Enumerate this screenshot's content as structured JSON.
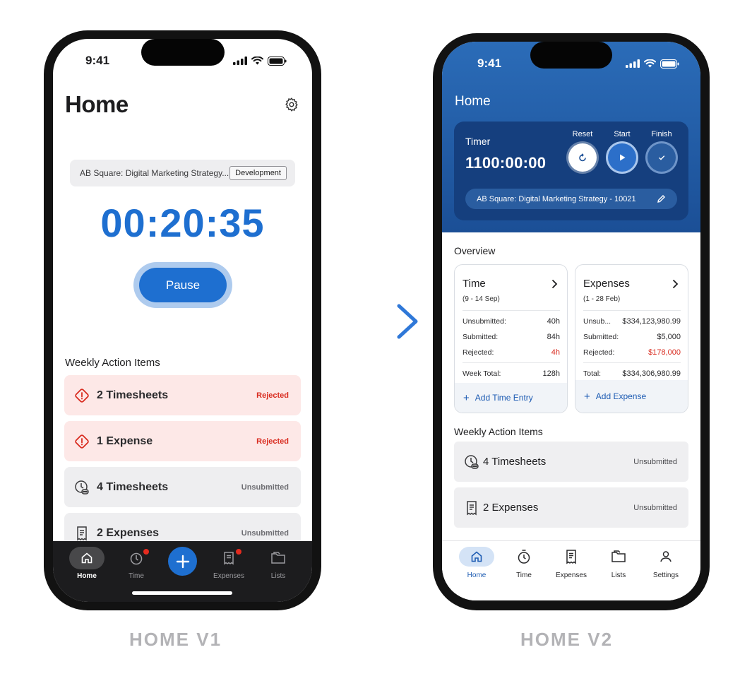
{
  "phone1": {
    "status_time": "9:41",
    "title": "Home",
    "project": "AB Square: Digital Marketing Strategy...",
    "tag": "Development",
    "timer": "00:20:35",
    "pause_label": "Pause",
    "section_title": "Weekly Action Items",
    "items": [
      {
        "label": "2 Timesheets",
        "status": "Rejected",
        "icon": "warning-diamond-icon"
      },
      {
        "label": "1 Expense",
        "status": "Rejected",
        "icon": "warning-diamond-icon"
      },
      {
        "label": "4 Timesheets",
        "status": "Unsubmitted",
        "icon": "clock-icon"
      },
      {
        "label": "2 Expenses",
        "status": "Unsubmitted",
        "icon": "receipt-icon"
      }
    ],
    "tabs": [
      "Home",
      "Time",
      "Expenses",
      "Lists"
    ],
    "colors": {
      "accent": "#1e6fd0",
      "rejected_bg": "#fde8e7",
      "rejected_text": "#d92c20",
      "tabbar": "#1c1c1e"
    }
  },
  "phone2": {
    "status_time": "9:41",
    "title": "Home",
    "timer_label": "Timer",
    "timer_value": "1100:00:00",
    "controls": [
      "Reset",
      "Start",
      "Finish"
    ],
    "project": "AB Square: Digital Marketing Strategy - 10021",
    "overview_title": "Overview",
    "time_card": {
      "title": "Time",
      "range": "(9 - 14 Sep)",
      "rows": [
        {
          "label": "Unsubmitted:",
          "value": "40h"
        },
        {
          "label": "Submitted:",
          "value": "84h"
        },
        {
          "label": "Rejected:",
          "value": "4h"
        }
      ],
      "total_label": "Week Total:",
      "total_value": "128h",
      "action": "Add Time Entry"
    },
    "expense_card": {
      "title": "Expenses",
      "range": "(1 - 28 Feb)",
      "rows": [
        {
          "label": "Unsub...",
          "value": "$334,123,980.99"
        },
        {
          "label": "Submitted:",
          "value": "$5,000"
        },
        {
          "label": "Rejected:",
          "value": "$178,000"
        }
      ],
      "total_label": "Total:",
      "total_value": "$334,306,980.99",
      "action": "Add Expense"
    },
    "section_title": "Weekly Action Items",
    "items": [
      {
        "label": "4 Timesheets",
        "status": "Unsubmitted",
        "icon": "clock-icon"
      },
      {
        "label": "2 Expenses",
        "status": "Unsubmitted",
        "icon": "receipt-icon"
      }
    ],
    "tabs": [
      "Home",
      "Time",
      "Expenses",
      "Lists",
      "Settings"
    ],
    "colors": {
      "header_top": "#2b6cb8",
      "header_bottom": "#1b4f96",
      "card": "#153f7e",
      "link": "#1e5cb3",
      "rejected": "#d92c20"
    }
  },
  "captions": {
    "v1": "HOME V1",
    "v2": "HOME V2"
  }
}
